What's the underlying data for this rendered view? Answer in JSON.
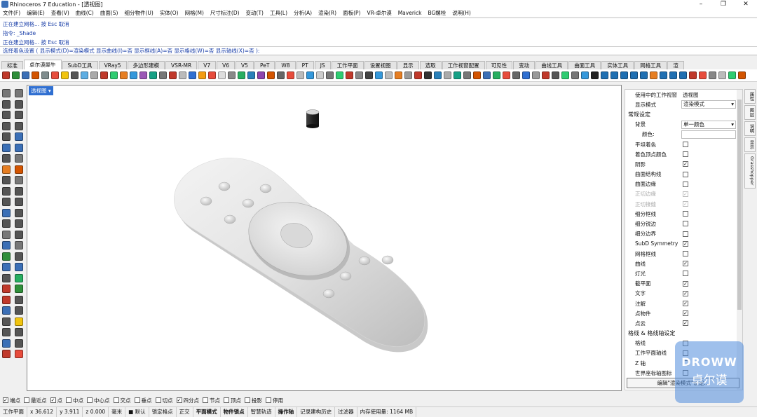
{
  "window": {
    "title": "Rhinoceros 7 Education - [透视图]",
    "minimize": "–",
    "maximize": "❐",
    "close": "✕"
  },
  "menu": [
    "文件(F)",
    "编辑(E)",
    "查看(V)",
    "曲线(C)",
    "曲面(S)",
    "细分物件(U)",
    "实体(O)",
    "网格(M)",
    "尺寸标注(D)",
    "变动(T)",
    "工具(L)",
    "分析(A)",
    "渲染(R)",
    "面板(P)",
    "VR-卓尔谟",
    "Maverick",
    "BG螺栓",
    "说明(H)"
  ],
  "command_history": [
    "正在建立网格... 按 Esc 取消",
    "指令: _Shade",
    "正在建立网格... 按 Esc 取消"
  ],
  "command_prompt": "选择着色设置 ( 显示模式(D)=渲染模式  显示曲线(I)=否  显示框线(A)=否  显示格线(W)=否  显示轴线(X)=否 ):",
  "tabs": [
    "标准",
    "卓尔谟犀牛",
    "SubD工具",
    "VRay5",
    "多边形建模",
    "VSR-MR",
    "V7",
    "V6",
    "V5",
    "PeT",
    "W8",
    "PT",
    "JS",
    "工作平面",
    "设置视图",
    "显示",
    "选取",
    "工作视窗配置",
    "可见性",
    "变动",
    "曲线工具",
    "曲面工具",
    "实体工具",
    "网格工具",
    "渲"
  ],
  "active_tab": 1,
  "toolbar_colors": [
    "#c0392b",
    "#2f8f3a",
    "#3b6fb6",
    "#d35400",
    "#7f8c8d",
    "#e74c3c",
    "#f1c40f",
    "#555",
    "#5dade2",
    "#aaa",
    "#c0392b",
    "#2ecc71",
    "#e67e22",
    "#3498db",
    "#9b59b6",
    "#16a085",
    "#777",
    "#c0392b",
    "#bbb",
    "#2f6fd1",
    "#f39c12",
    "#e74c3c",
    "#ddd",
    "#888",
    "#27ae60",
    "#2980b9",
    "#8e44ad",
    "#d35400",
    "#666",
    "#e74c3c",
    "#bbb",
    "#3498db",
    "#ccc",
    "#777",
    "#2ecc71",
    "#c0392b",
    "#888",
    "#444",
    "#3498db",
    "#bbb",
    "#e67e22",
    "#999",
    "#c0392b",
    "#333",
    "#2980b9",
    "#aaa",
    "#16a085",
    "#777",
    "#d35400",
    "#3b6fb6",
    "#27ae60",
    "#e74c3c",
    "#666",
    "#2f6fd1",
    "#999",
    "#c0392b",
    "#555",
    "#2ecc71",
    "#777",
    "#3498db",
    "#222",
    "#1f6fb2",
    "#1f6fb2",
    "#1f6fb2",
    "#1f6fb2",
    "#1f6fb2",
    "#e67e22",
    "#1f6fb2",
    "#1f6fb2",
    "#1f6fb2",
    "#c0392b",
    "#e74c3c",
    "#888",
    "#bbb",
    "#2ecc71",
    "#d35400"
  ],
  "left_tool_colors": [
    "#777",
    "#777",
    "#555",
    "#555",
    "#555",
    "#555",
    "#555",
    "#555",
    "#555",
    "#3b6fb6",
    "#3b6fb6",
    "#3b6fb6",
    "#555",
    "#777",
    "#e67e22",
    "#d35400",
    "#555",
    "#777",
    "#555",
    "#555",
    "#555",
    "#555",
    "#3b6fb6",
    "#555",
    "#555",
    "#555",
    "#777",
    "#555",
    "#3b6fb6",
    "#777",
    "#2f8f3a",
    "#555",
    "#3b6fb6",
    "#3b6fb6",
    "#555",
    "#27ae60",
    "#c0392b",
    "#2f8f3a",
    "#c0392b",
    "#555",
    "#3b6fb6",
    "#555",
    "#555",
    "#f1c40f",
    "#555",
    "#555",
    "#3b6fb6",
    "#555",
    "#c0392b",
    "#e74c3c"
  ],
  "viewport": {
    "label": "透视图 ▾"
  },
  "panel": {
    "rows": [
      {
        "kind": "kv",
        "label": "使用中的工作视窗",
        "value": "透视图"
      },
      {
        "kind": "dropdown",
        "label": "显示模式",
        "value": "渲染模式"
      },
      {
        "kind": "section",
        "label": "常规设定"
      },
      {
        "kind": "dropdown",
        "label": "背景",
        "value": "单一颜色"
      },
      {
        "kind": "field",
        "label": "颜色:"
      },
      {
        "kind": "check",
        "label": "平坦着色",
        "checked": false
      },
      {
        "kind": "check",
        "label": "着色顶点颜色",
        "checked": false
      },
      {
        "kind": "check",
        "label": "阴影",
        "checked": true
      },
      {
        "kind": "check",
        "label": "曲面结构线",
        "checked": false
      },
      {
        "kind": "check",
        "label": "曲面边缘",
        "checked": false
      },
      {
        "kind": "check",
        "label": "正切边缘",
        "checked": true,
        "dim": true
      },
      {
        "kind": "check",
        "label": "正切接缝",
        "checked": true,
        "dim": true
      },
      {
        "kind": "check",
        "label": "细分框线",
        "checked": false
      },
      {
        "kind": "check",
        "label": "细分锐边",
        "checked": false
      },
      {
        "kind": "check",
        "label": "细分边界",
        "checked": false
      },
      {
        "kind": "check",
        "label": "SubD Symmetry",
        "checked": true
      },
      {
        "kind": "check",
        "label": "网格框线",
        "checked": false
      },
      {
        "kind": "check",
        "label": "曲线",
        "checked": true
      },
      {
        "kind": "check",
        "label": "灯光",
        "checked": false
      },
      {
        "kind": "check",
        "label": "截平面",
        "checked": true
      },
      {
        "kind": "check",
        "label": "文字",
        "checked": true
      },
      {
        "kind": "check",
        "label": "注解",
        "checked": true
      },
      {
        "kind": "check",
        "label": "点物件",
        "checked": true
      },
      {
        "kind": "check",
        "label": "点云",
        "checked": true
      },
      {
        "kind": "section",
        "label": "格线 & 格线轴设定"
      },
      {
        "kind": "check",
        "label": "格线",
        "checked": false
      },
      {
        "kind": "check",
        "label": "工作平面轴线",
        "checked": false
      },
      {
        "kind": "check",
        "label": "Z 轴",
        "checked": false
      },
      {
        "kind": "check",
        "label": "世界座标轴图标",
        "checked": false
      }
    ],
    "edit_button": "编辑\"渲染模式\"设定..."
  },
  "side_tabs": [
    "属性",
    "图层",
    "说明",
    "显示",
    "Grasshopper"
  ],
  "osnap": [
    {
      "label": "端点",
      "checked": true
    },
    {
      "label": "最近点",
      "checked": false
    },
    {
      "label": "点",
      "checked": true
    },
    {
      "label": "中点",
      "checked": false
    },
    {
      "label": "中心点",
      "checked": false
    },
    {
      "label": "交点",
      "checked": false
    },
    {
      "label": "垂点",
      "checked": false
    },
    {
      "label": "切点",
      "checked": false
    },
    {
      "label": "四分点",
      "checked": true
    },
    {
      "label": "节点",
      "checked": false
    },
    {
      "label": "顶点",
      "checked": false
    },
    {
      "label": "投影",
      "checked": false
    },
    {
      "label": "停用",
      "checked": false
    }
  ],
  "status": [
    {
      "text": "工作平面"
    },
    {
      "text": "x 36.612"
    },
    {
      "text": "y 3.911"
    },
    {
      "text": "z 0.000"
    },
    {
      "text": "毫米"
    },
    {
      "text": "■ 默认"
    },
    {
      "text": "锁定格点"
    },
    {
      "text": "正交"
    },
    {
      "text": "平面模式",
      "bold": true
    },
    {
      "text": "物件锁点",
      "bold": true
    },
    {
      "text": "智慧轨迹"
    },
    {
      "text": "操作轴",
      "bold": true
    },
    {
      "text": "记录建构历史"
    },
    {
      "text": "过滤器"
    },
    {
      "text": "内存使用量: 1164 MB"
    }
  ],
  "watermark": {
    "line1": "DROWW",
    "line2": "卓尔谟"
  }
}
